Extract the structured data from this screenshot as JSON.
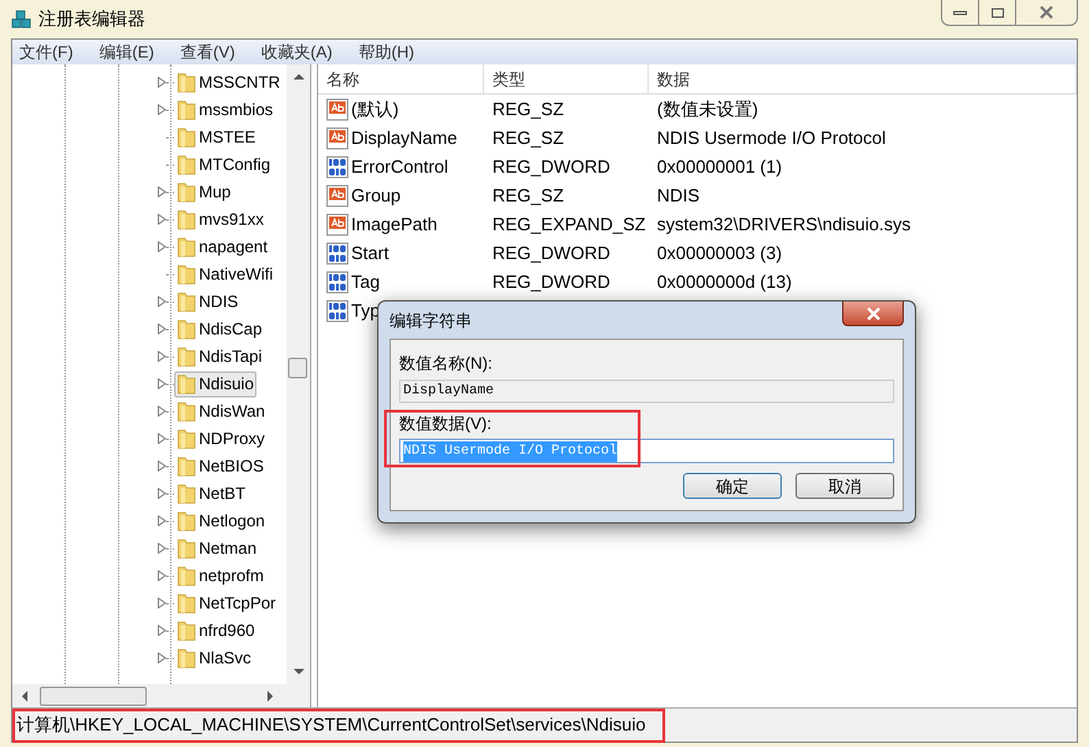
{
  "window": {
    "title": "注册表编辑器"
  },
  "menu": [
    "文件(F)",
    "编辑(E)",
    "查看(V)",
    "收藏夹(A)",
    "帮助(H)"
  ],
  "tree": [
    {
      "label": "MSSCNTR",
      "expandable": true,
      "selected": false
    },
    {
      "label": "mssmbios",
      "expandable": true,
      "selected": false
    },
    {
      "label": "MSTEE",
      "expandable": false,
      "selected": false
    },
    {
      "label": "MTConfig",
      "expandable": false,
      "selected": false
    },
    {
      "label": "Mup",
      "expandable": true,
      "selected": false
    },
    {
      "label": "mvs91xx",
      "expandable": true,
      "selected": false
    },
    {
      "label": "napagent",
      "expandable": true,
      "selected": false
    },
    {
      "label": "NativeWifi",
      "expandable": false,
      "selected": false
    },
    {
      "label": "NDIS",
      "expandable": true,
      "selected": false
    },
    {
      "label": "NdisCap",
      "expandable": true,
      "selected": false
    },
    {
      "label": "NdisTapi",
      "expandable": true,
      "selected": false
    },
    {
      "label": "Ndisuio",
      "expandable": true,
      "selected": true
    },
    {
      "label": "NdisWan",
      "expandable": true,
      "selected": false
    },
    {
      "label": "NDProxy",
      "expandable": true,
      "selected": false
    },
    {
      "label": "NetBIOS",
      "expandable": true,
      "selected": false
    },
    {
      "label": "NetBT",
      "expandable": true,
      "selected": false
    },
    {
      "label": "Netlogon",
      "expandable": true,
      "selected": false
    },
    {
      "label": "Netman",
      "expandable": true,
      "selected": false
    },
    {
      "label": "netprofm",
      "expandable": true,
      "selected": false
    },
    {
      "label": "NetTcpPor",
      "expandable": true,
      "selected": false
    },
    {
      "label": "nfrd960",
      "expandable": true,
      "selected": false
    },
    {
      "label": "NlaSvc",
      "expandable": true,
      "selected": false
    }
  ],
  "table": {
    "columns": [
      "名称",
      "类型",
      "数据"
    ],
    "rows": [
      {
        "kind": "string",
        "name": "(默认)",
        "type": "REG_SZ",
        "data": "(数值未设置)"
      },
      {
        "kind": "string",
        "name": "DisplayName",
        "type": "REG_SZ",
        "data": "NDIS Usermode I/O Protocol"
      },
      {
        "kind": "binary",
        "name": "ErrorControl",
        "type": "REG_DWORD",
        "data": "0x00000001 (1)"
      },
      {
        "kind": "string",
        "name": "Group",
        "type": "REG_SZ",
        "data": "NDIS"
      },
      {
        "kind": "string",
        "name": "ImagePath",
        "type": "REG_EXPAND_SZ",
        "data": "system32\\DRIVERS\\ndisuio.sys"
      },
      {
        "kind": "binary",
        "name": "Start",
        "type": "REG_DWORD",
        "data": "0x00000003 (3)"
      },
      {
        "kind": "binary",
        "name": "Tag",
        "type": "REG_DWORD",
        "data": "0x0000000d (13)"
      },
      {
        "kind": "binary",
        "name": "Typ"
      }
    ]
  },
  "dialog": {
    "title": "编辑字符串",
    "name_label": "数值名称(N):",
    "name_value": "DisplayName",
    "data_label": "数值数据(V):",
    "data_value": "NDIS Usermode I/O Protocol",
    "buttons": [
      "确定",
      "取消"
    ]
  },
  "status_bar": "计算机\\HKEY_LOCAL_MACHINE\\SYSTEM\\CurrentControlSet\\services\\Ndisuio"
}
